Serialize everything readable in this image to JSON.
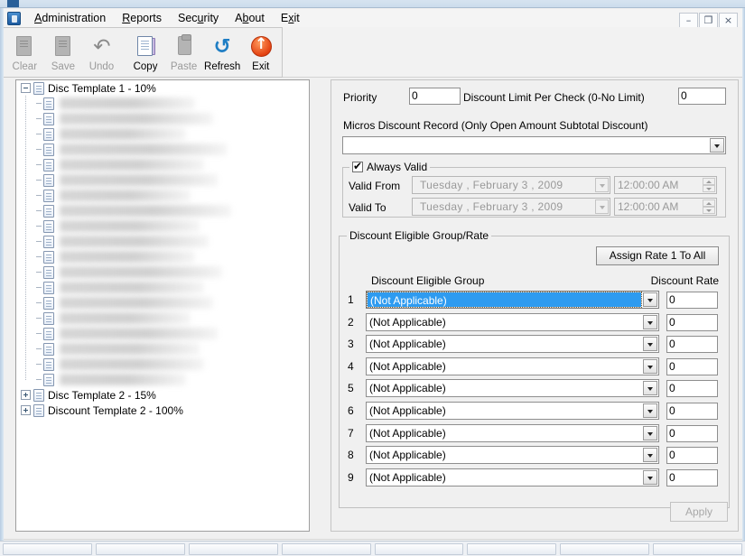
{
  "window": {
    "outer_title": "",
    "mdi_minimize": "–",
    "mdi_restore": "❐",
    "mdi_close": "×"
  },
  "menubar": {
    "items": [
      {
        "label": "Administration",
        "accel": "A"
      },
      {
        "label": "Reports",
        "accel": "R"
      },
      {
        "label": "Security",
        "accel": "u"
      },
      {
        "label": "About",
        "accel": "b"
      },
      {
        "label": "Exit",
        "accel": "x"
      }
    ]
  },
  "toolbar": {
    "buttons": [
      {
        "label": "Clear",
        "icon": "clear-document-icon",
        "enabled": false
      },
      {
        "label": "Save",
        "icon": "save-disk-icon",
        "enabled": false
      },
      {
        "label": "Undo",
        "icon": "undo-arrow-icon",
        "enabled": false
      },
      {
        "label": "Copy",
        "icon": "copy-documents-icon",
        "enabled": true
      },
      {
        "label": "Paste",
        "icon": "paste-clipboard-icon",
        "enabled": false
      },
      {
        "label": "Refresh",
        "icon": "refresh-arrows-icon",
        "enabled": true
      },
      {
        "label": "Exit",
        "icon": "exit-up-arrow-icon",
        "enabled": true
      }
    ]
  },
  "tree": {
    "nodes": [
      {
        "label": "Disc Template 1 - 10%",
        "expanded": true,
        "child_count": 19
      },
      {
        "label": "Disc Template 2 - 15%",
        "expanded": false,
        "child_count": 0
      },
      {
        "label": "Discount Template 2 - 100%",
        "expanded": false,
        "child_count": 0
      }
    ]
  },
  "form": {
    "priority_label": "Priority",
    "priority_value": "0",
    "discount_limit_label": "Discount Limit Per Check (0-No Limit)",
    "discount_limit_value": "0",
    "micros_record_label": "Micros Discount Record (Only Open Amount Subtotal Discount)",
    "micros_record_value": ""
  },
  "validity": {
    "always_valid_label": "Always Valid",
    "always_valid_checked": true,
    "valid_from_label": "Valid From",
    "valid_from_date": "Tuesday  ,  February    3 , 2009",
    "valid_from_time": "12:00:00 AM",
    "valid_to_label": "Valid To",
    "valid_to_date": "Tuesday  ,  February    3 , 2009",
    "valid_to_time": "12:00:00 AM",
    "enabled": false
  },
  "eligible": {
    "group_title": "Discount Eligible Group/Rate",
    "assign_button_label": "Assign Rate 1 To All",
    "col_group_label": "Discount Eligible Group",
    "col_rate_label": "Discount Rate",
    "rows": [
      {
        "num": "1",
        "group": "(Not Applicable)",
        "rate": "0",
        "selected": true
      },
      {
        "num": "2",
        "group": "(Not Applicable)",
        "rate": "0",
        "selected": false
      },
      {
        "num": "3",
        "group": "(Not Applicable)",
        "rate": "0",
        "selected": false
      },
      {
        "num": "4",
        "group": "(Not Applicable)",
        "rate": "0",
        "selected": false
      },
      {
        "num": "5",
        "group": "(Not Applicable)",
        "rate": "0",
        "selected": false
      },
      {
        "num": "6",
        "group": "(Not Applicable)",
        "rate": "0",
        "selected": false
      },
      {
        "num": "7",
        "group": "(Not Applicable)",
        "rate": "0",
        "selected": false
      },
      {
        "num": "8",
        "group": "(Not Applicable)",
        "rate": "0",
        "selected": false
      },
      {
        "num": "9",
        "group": "(Not Applicable)",
        "rate": "0",
        "selected": false
      }
    ]
  },
  "footer": {
    "apply_label": "Apply",
    "apply_enabled": false
  },
  "colors": {
    "selection_blue": "#2e9bf0",
    "window_bg": "#f0f0f0",
    "field_bg": "#ffffff",
    "disabled_text": "#999999"
  }
}
